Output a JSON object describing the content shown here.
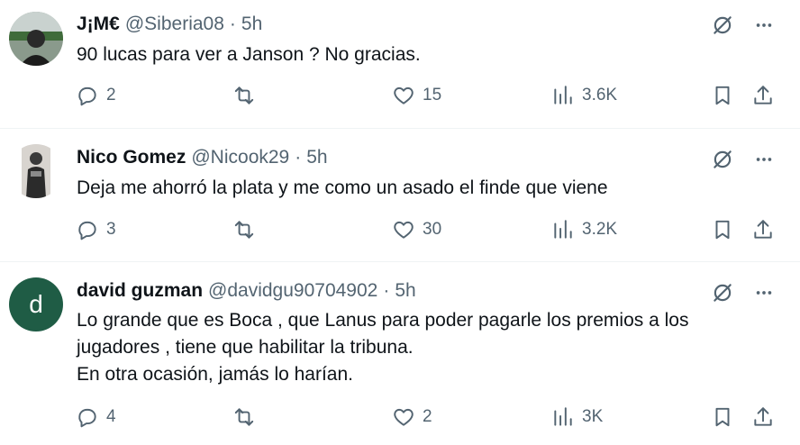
{
  "tweets": [
    {
      "name": "J¡M€",
      "handle": "@Siberia08",
      "time": "5h",
      "lines": [
        "90 lucas para ver a Janson ? No gracias."
      ],
      "replies": "2",
      "retweets": "",
      "likes": "15",
      "views": "3.6K"
    },
    {
      "name": "Nico Gomez",
      "handle": "@Nicook29",
      "time": "5h",
      "lines": [
        "Deja me ahorró la plata y me como un asado el finde que viene"
      ],
      "replies": "3",
      "retweets": "",
      "likes": "30",
      "views": "3.2K"
    },
    {
      "name": "david guzman",
      "handle": "@davidgu90704902",
      "time": "5h",
      "avatar_letter": "d",
      "lines": [
        "Lo grande que es Boca , que Lanus para poder pagarle los premios a los",
        "jugadores , tiene que habilitar la tribuna.",
        "En otra ocasión, jamás lo harían."
      ],
      "replies": "4",
      "retweets": "",
      "likes": "2",
      "views": "3K"
    }
  ],
  "separator": "·",
  "icons": {
    "grok": "grok-icon",
    "more": "more-icon",
    "reply": "reply-icon",
    "retweet": "retweet-icon",
    "like": "heart-icon",
    "views": "views-icon",
    "bookmark": "bookmark-icon",
    "share": "share-icon"
  },
  "colors": {
    "text": "#0f1419",
    "muted": "#536471",
    "divider": "#eff3f4",
    "avatar_letter_bg": "#1f5c45"
  }
}
